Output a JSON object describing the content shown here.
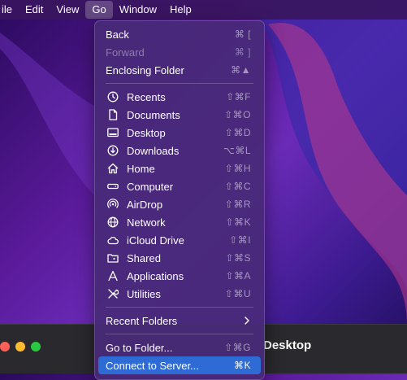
{
  "menubar": {
    "items": [
      "ile",
      "Edit",
      "View",
      "Go",
      "Window",
      "Help"
    ],
    "active": "Go"
  },
  "go_menu": {
    "nav": [
      {
        "label": "Back",
        "shortcut": "⌘ ["
      },
      {
        "label": "Forward",
        "shortcut": "⌘ ]",
        "disabled": true
      },
      {
        "label": "Enclosing Folder",
        "shortcut": "⌘▲"
      }
    ],
    "places": [
      {
        "label": "Recents",
        "shortcut": "⇧⌘F",
        "icon": "clock-icon"
      },
      {
        "label": "Documents",
        "shortcut": "⇧⌘O",
        "icon": "document-icon"
      },
      {
        "label": "Desktop",
        "shortcut": "⇧⌘D",
        "icon": "desktop-icon"
      },
      {
        "label": "Downloads",
        "shortcut": "⌥⌘L",
        "icon": "download-icon"
      },
      {
        "label": "Home",
        "shortcut": "⇧⌘H",
        "icon": "home-icon"
      },
      {
        "label": "Computer",
        "shortcut": "⇧⌘C",
        "icon": "computer-icon"
      },
      {
        "label": "AirDrop",
        "shortcut": "⇧⌘R",
        "icon": "airdrop-icon"
      },
      {
        "label": "Network",
        "shortcut": "⇧⌘K",
        "icon": "globe-icon"
      },
      {
        "label": "iCloud Drive",
        "shortcut": "⇧⌘I",
        "icon": "cloud-icon"
      },
      {
        "label": "Shared",
        "shortcut": "⇧⌘S",
        "icon": "shared-folder-icon"
      },
      {
        "label": "Applications",
        "shortcut": "⇧⌘A",
        "icon": "applications-icon"
      },
      {
        "label": "Utilities",
        "shortcut": "⇧⌘U",
        "icon": "tools-icon"
      }
    ],
    "recent_folders": {
      "label": "Recent Folders"
    },
    "go_to_folder": {
      "label": "Go to Folder...",
      "shortcut": "⇧⌘G"
    },
    "connect_to_server": {
      "label": "Connect to Server...",
      "shortcut": "⌘K"
    }
  },
  "finder_window": {
    "title": "Desktop"
  },
  "colors": {
    "highlight": "#2f6bd4",
    "menu_bg": "#482a78"
  }
}
